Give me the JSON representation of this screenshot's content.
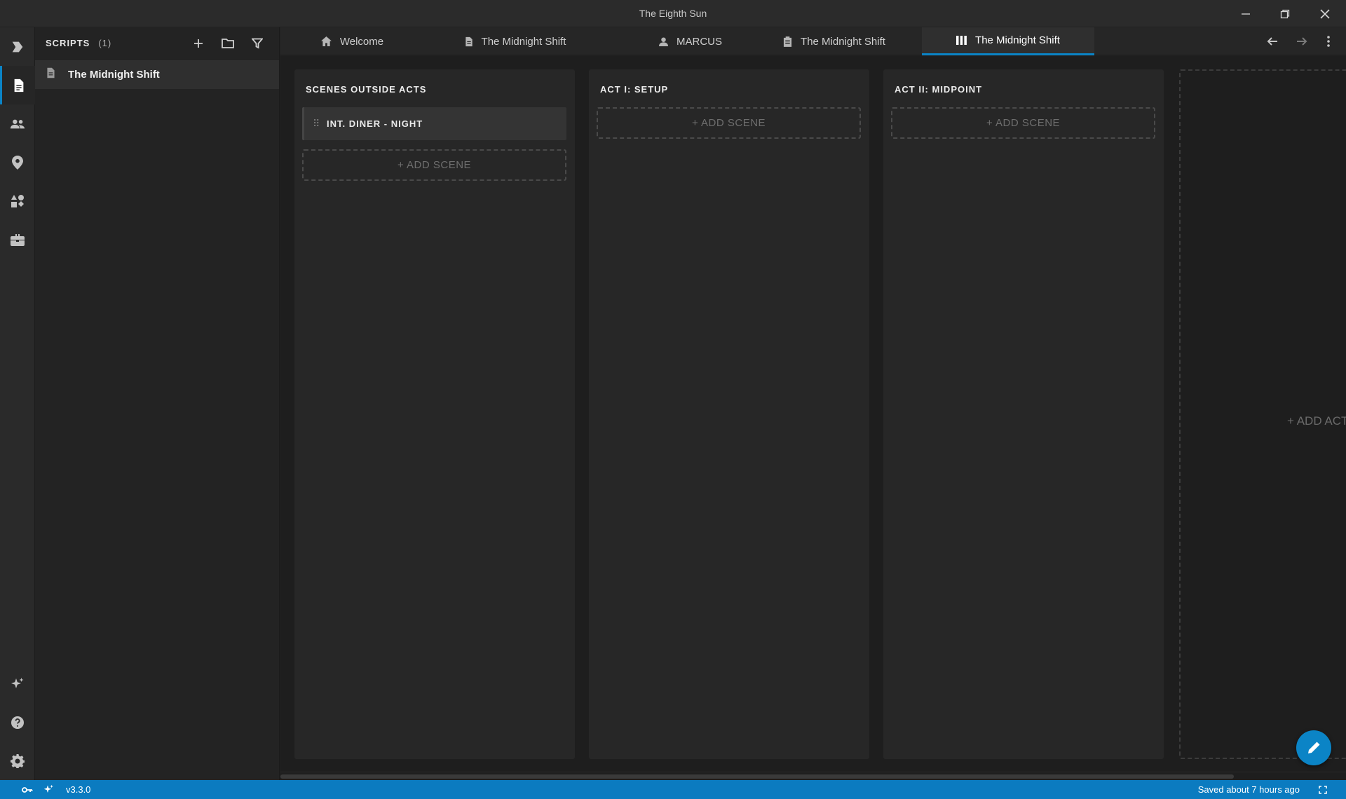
{
  "window": {
    "title": "The Eighth Sun"
  },
  "activity_bar": {
    "items": [
      {
        "icon": "app-logo-icon"
      },
      {
        "icon": "document-icon",
        "active": true
      },
      {
        "icon": "people-icon"
      },
      {
        "icon": "location-pin-icon"
      },
      {
        "icon": "shapes-icon"
      },
      {
        "icon": "toolbox-icon"
      }
    ],
    "bottom_items": [
      {
        "icon": "sparkle-icon"
      },
      {
        "icon": "help-icon"
      },
      {
        "icon": "gear-icon"
      }
    ]
  },
  "sidebar": {
    "header": "SCRIPTS",
    "count": "(1)",
    "items": [
      {
        "label": "The Midnight Shift",
        "icon": "document-icon"
      }
    ]
  },
  "tabs": [
    {
      "label": "Welcome",
      "icon": "home-icon"
    },
    {
      "label": "The Midnight Shift",
      "icon": "document-icon"
    },
    {
      "label": "MARCUS",
      "icon": "person-icon"
    },
    {
      "label": "The Midnight Shift",
      "icon": "clipboard-icon"
    },
    {
      "label": "The Midnight Shift",
      "icon": "board-columns-icon",
      "active": true
    }
  ],
  "board": {
    "columns": [
      {
        "title": "SCENES OUTSIDE ACTS",
        "scenes": [
          "INT. DINER - NIGHT"
        ],
        "add_label": "+ ADD SCENE"
      },
      {
        "title": "ACT I: SETUP",
        "scenes": [],
        "add_label": "+ ADD SCENE"
      },
      {
        "title": "ACT II: MIDPOINT",
        "scenes": [],
        "add_label": "+ ADD SCENE"
      }
    ],
    "add_act_label": "+ ADD ACT"
  },
  "statusbar": {
    "version": "v3.3.0",
    "saved": "Saved about 7 hours ago"
  },
  "colors": {
    "accent": "#0b84c6",
    "statusbar": "#0b7bc0",
    "background": "#1e1e1e"
  }
}
